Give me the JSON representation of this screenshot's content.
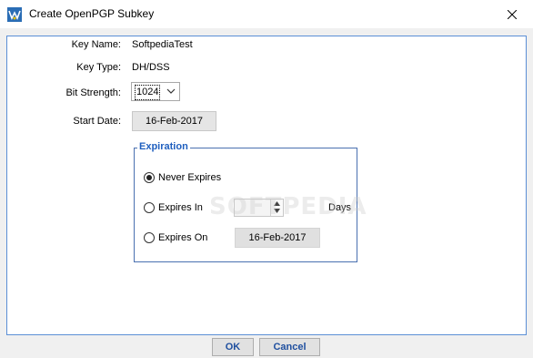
{
  "window": {
    "title": "Create OpenPGP Subkey"
  },
  "form": {
    "key_name_label": "Key Name:",
    "key_name_value": "SoftpediaTest",
    "key_type_label": "Key Type:",
    "key_type_value": "DH/DSS",
    "bit_strength_label": "Bit Strength:",
    "bit_strength_value": "1024",
    "start_date_label": "Start Date:",
    "start_date_value": "16-Feb-2017"
  },
  "expiration": {
    "legend": "Expiration",
    "never_label": "Never Expires",
    "expires_in_label": "Expires In",
    "expires_in_value": "",
    "days_label": "Days",
    "expires_on_label": "Expires On",
    "expires_on_date": "16-Feb-2017",
    "selected": "never"
  },
  "buttons": {
    "ok": "OK",
    "cancel": "Cancel"
  },
  "watermark": "SOFTPEDIA",
  "colors": {
    "accent": "#1f5fbf",
    "panel_border": "#5b8fd6"
  },
  "icons": {
    "app": "openpgp-app-icon",
    "close": "close-icon",
    "dropdown": "chevron-down-icon"
  }
}
